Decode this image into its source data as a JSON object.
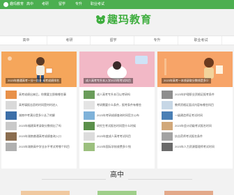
{
  "nav": {
    "brand": "趣玛教育",
    "items": [
      "高中",
      "考研",
      "留学",
      "专升",
      "职业考试"
    ]
  },
  "brand": {
    "name": "趣玛教育"
  },
  "tabs": [
    "高中",
    "考研",
    "留学",
    "专升",
    "职业考试"
  ],
  "columns": [
    {
      "caption": "2023年普通高考一分一段表 高考成绩排名",
      "items": [
        "高考成绩出来后，你需要立即做哪些事",
        "高考填报志愿的时间是何时进入",
        "湖南中考满分是多少丛了的解",
        "2023年福建高考录取分数线出了吗",
        "2023年湖南普通高考成绩查询入口",
        "2023年湖南高中学业水平考试考哪个科目"
      ]
    },
    {
      "caption": "成人高考专升本入学2023年考试科目",
      "items": [
        "成人高考专升本可以考研吗",
        "考研需要什么条件，报考条件有哪些",
        "2023年考研成绩查询时间官方公布",
        "研究生考试报名时间是什么时候",
        "2023年度成人高考考试科目",
        "2023年国际学校收费多少钱"
      ]
    },
    {
      "caption": "2023年高考一本线录取分数线是多少",
      "items": [
        "2023年护理职业资格证报考条件",
        "教师资格证面试内容有哪些科目",
        "一级建造师证考试时间",
        "2023年会计初级考试报名时间",
        "执业药师考试报名条件",
        "2023年人力资源管理师考试时间"
      ]
    }
  ],
  "section": {
    "title": "高中"
  },
  "colors": {
    "accent": "#4caf50",
    "brand_green": "#3fae3f",
    "banner1": "#f5a65b",
    "banner2": "#f2b8c6",
    "banner3": "#f7a468"
  }
}
